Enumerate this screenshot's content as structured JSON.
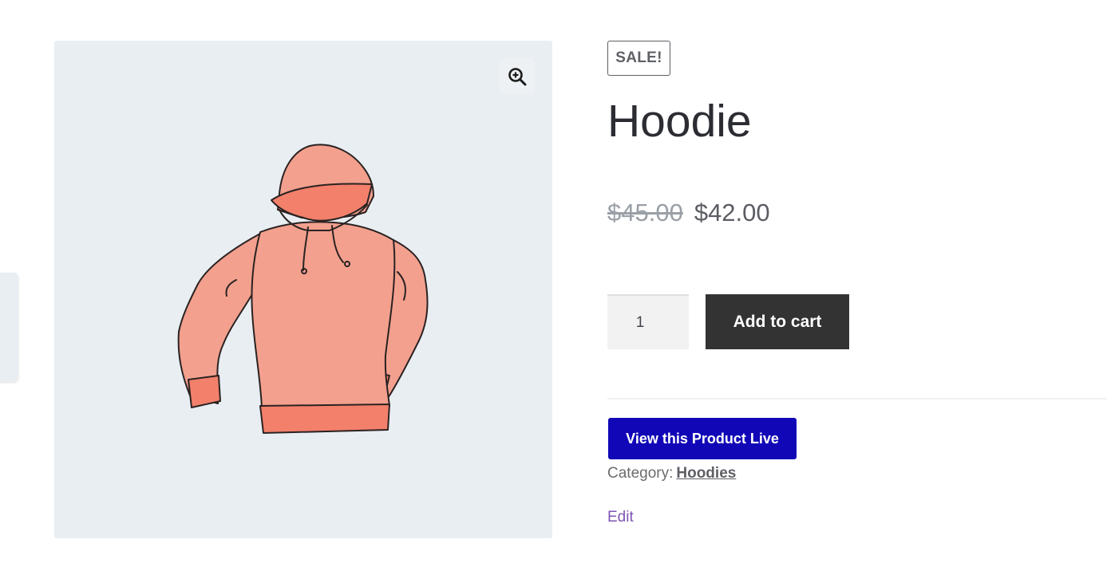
{
  "product": {
    "badge": "SALE!",
    "title": "Hoodie",
    "price_old": "$45.00",
    "price_new": "$42.00",
    "quantity": "1",
    "add_to_cart_label": "Add to cart",
    "view_live_label": "View this Product Live",
    "category_label": "Category:",
    "category_value": "Hoodies",
    "edit_label": "Edit"
  },
  "gallery": {
    "zoom_icon": "zoom-in-icon",
    "image_subject": "hoodie"
  },
  "colors": {
    "gallery_bg": "#e9eef2",
    "add_to_cart_bg": "#333333",
    "view_live_bg": "#1107b7",
    "edit_link": "#7f54b3",
    "hoodie_fill": "#f3a08e",
    "hoodie_accent": "#f26b55"
  }
}
